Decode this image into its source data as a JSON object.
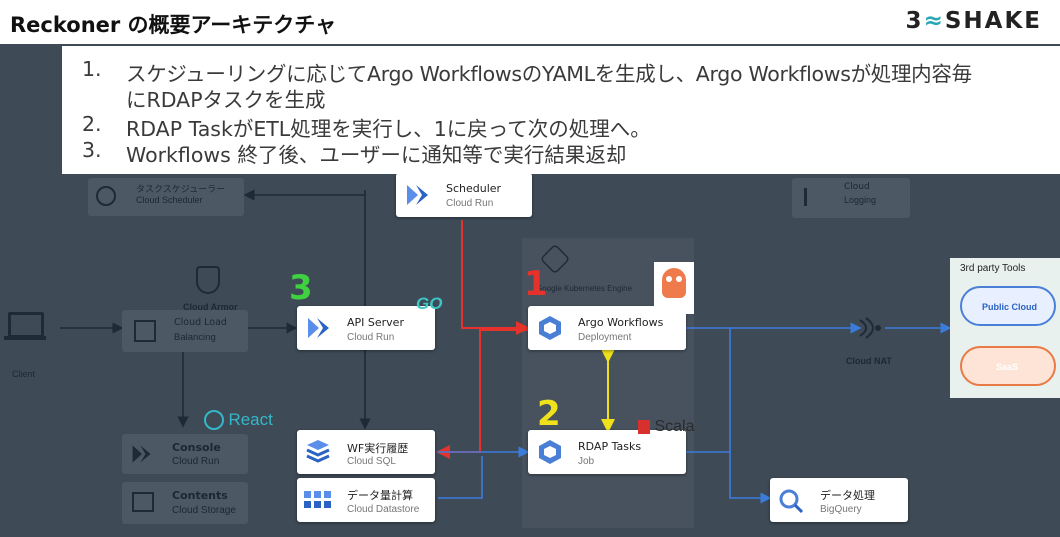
{
  "header": {
    "title": "Reckoner の概要アーキテクチャ",
    "logo_left": "3",
    "logo_mark": "≈",
    "logo_right": "SHAKE"
  },
  "steps": [
    {
      "num": "1.",
      "text": "スケジューリングに応じてArgo WorkflowsのYAMLを生成し、Argo Workflowsが処理内容毎"
    },
    {
      "num": "",
      "text": "にRDAPタスクを生成"
    },
    {
      "num": "2.",
      "text": "RDAP TaskがETL処理を実行し、1に戻って次の処理へ。"
    },
    {
      "num": "3.",
      "text": "Workflows 終了後、ユーザーに通知等で実行結果返却"
    }
  ],
  "nodes": {
    "client": {
      "label": "Client"
    },
    "scheduler_dim": {
      "name": "タスクスケジューラー",
      "sub": "Cloud Scheduler"
    },
    "logging": {
      "name": "Cloud",
      "sub": "Logging"
    },
    "armor": {
      "label": "Cloud Armor"
    },
    "lb": {
      "name": "Cloud Load",
      "sub": "Balancing"
    },
    "scheduler": {
      "name": "Scheduler",
      "sub": "Cloud Run"
    },
    "api": {
      "name": "API Server",
      "sub": "Cloud Run"
    },
    "gke": {
      "label": "Google Kubernetes Engine"
    },
    "argo": {
      "name": "Argo Workflows",
      "sub": "Deployment"
    },
    "rdap": {
      "name": "RDAP Tasks",
      "sub": "Job"
    },
    "console": {
      "name": "Console",
      "sub": "Cloud Run"
    },
    "contents": {
      "name": "Contents",
      "sub": "Cloud Storage"
    },
    "wf": {
      "name": "WF実行履歴",
      "sub": "Cloud SQL"
    },
    "datastore": {
      "name": "データ量計算",
      "sub": "Cloud Datastore"
    },
    "bq": {
      "name": "データ処理",
      "sub": "BigQuery"
    },
    "nat": {
      "label": "Cloud NAT"
    },
    "thirdparty": {
      "title": "3rd party Tools",
      "public": "Public Cloud",
      "saas": "SaaS"
    }
  },
  "badges": {
    "go": "GO",
    "react": "React",
    "scala": "Scala"
  },
  "numbers": {
    "n1": "1",
    "n2": "2",
    "n3": "3"
  },
  "colors": {
    "red": "#e5322b",
    "yellow": "#f0e21a",
    "green": "#3fd13f",
    "blue": "#3b7ddd"
  }
}
